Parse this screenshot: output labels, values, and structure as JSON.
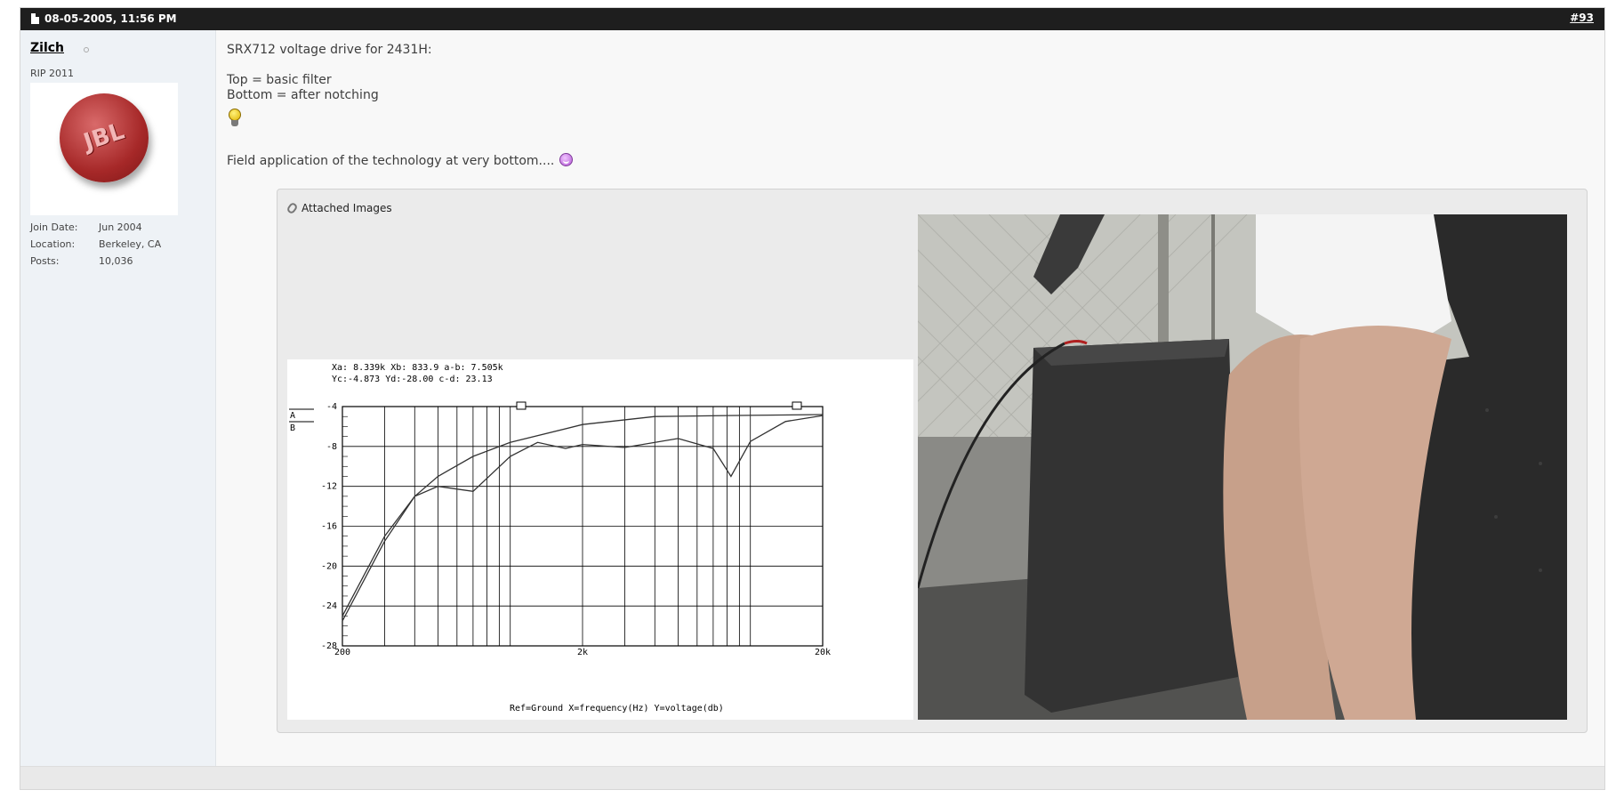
{
  "post": {
    "date": "08-05-2005, 11:56 PM",
    "number": "#93"
  },
  "user": {
    "name": "Zilch",
    "title": "RIP 2011",
    "avatar_text": "JBL",
    "join_label": "Join Date:",
    "join_value": "Jun 2004",
    "location_label": "Location:",
    "location_value": "Berkeley, CA",
    "posts_label": "Posts:",
    "posts_value": "10,036"
  },
  "message": {
    "line1": "SRX712 voltage drive for 2431H:",
    "line2": "Top = basic filter",
    "line3": "Bottom = after notching",
    "line4": "Field application of the technology at very bottom...."
  },
  "attachments": {
    "title": "Attached Images"
  },
  "graph": {
    "readout1": "Xa: 8.339k  Xb: 833.9   a-b: 7.505k",
    "readout2": "Yc:-4.873   Yd:-28.00   c-d: 23.13",
    "legend_a": "A",
    "legend_b": "B",
    "y_ticks": [
      "-4",
      "-8",
      "-12",
      "-16",
      "-20",
      "-24",
      "-28"
    ],
    "x_ticks": [
      "200",
      "2k",
      "20k"
    ],
    "footer": "Ref=Ground  X=frequency(Hz) Y=voltage(db)"
  },
  "icons": {
    "post_icon": "document-icon",
    "online_icon": "status-offline-icon",
    "bulb_icon": "lightbulb-icon",
    "smile_icon": "smile-icon",
    "attach_icon": "paperclip-icon"
  }
}
